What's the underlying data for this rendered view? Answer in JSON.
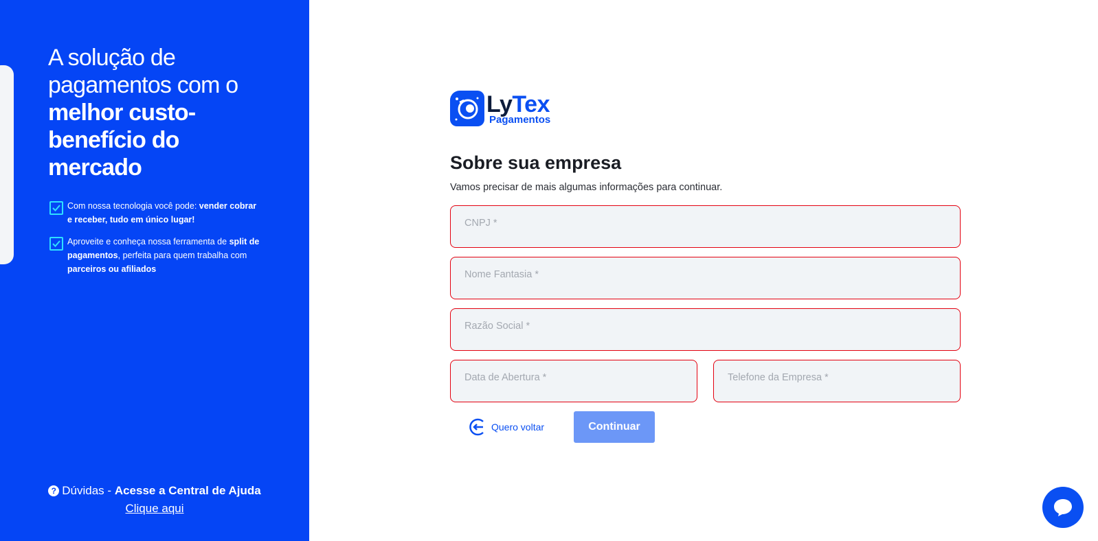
{
  "sidebar": {
    "headline_light": "A solução de pagamentos com o",
    "headline_bold": "melhor custo-benefício do mercado",
    "bullets": [
      {
        "pre": "Com nossa tecnologia você pode: ",
        "bold": "vender cobrar e receber, tudo em único lugar!"
      },
      {
        "pre": "Aproveite e conheça nossa ferramenta de ",
        "bold": "split de pagamentos",
        "mid": ", perfeita para quem trabalha com ",
        "bold2": "parceiros ou afiliados"
      }
    ],
    "help_prefix": "Dúvidas - ",
    "help_bold": "Acesse a Central de Ajuda",
    "help_link": "Clique aqui",
    "accent_color": "#0545f5"
  },
  "logo": {
    "ly": "Ly",
    "tex": "Tex",
    "sub": "Pagamentos"
  },
  "form": {
    "title": "Sobre sua empresa",
    "subtitle": "Vamos precisar de mais algumas informações para continuar.",
    "fields": {
      "cnpj": {
        "placeholder": "CNPJ *",
        "value": ""
      },
      "nome_fantasia": {
        "placeholder": "Nome Fantasia *",
        "value": ""
      },
      "razao_social": {
        "placeholder": "Razão Social *",
        "value": ""
      },
      "data_abertura": {
        "placeholder": "Data de Abertura *",
        "value": ""
      },
      "telefone": {
        "placeholder": "Telefone da Empresa *",
        "value": ""
      }
    },
    "error_color": "#e3000f",
    "back_label": "Quero voltar",
    "continue_label": "Continuar"
  }
}
